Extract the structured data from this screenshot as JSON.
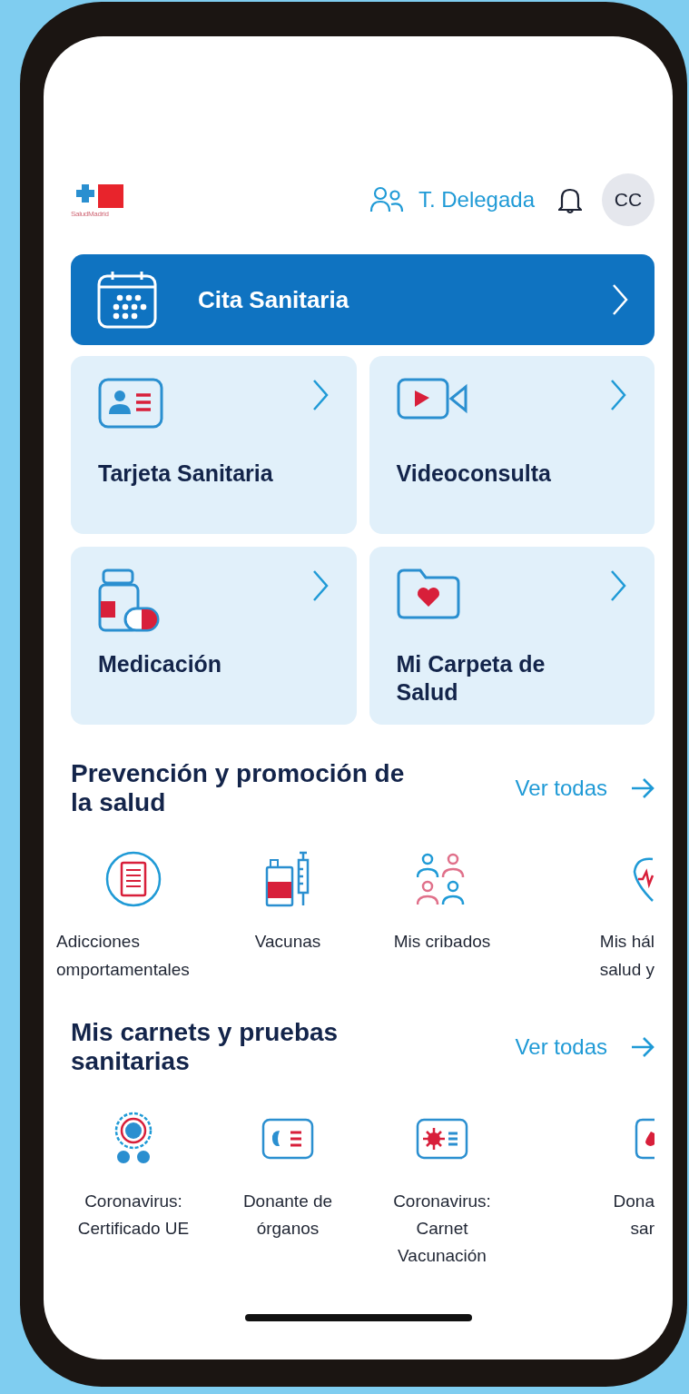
{
  "header": {
    "logo_text": "SaludMadrid",
    "delegate_label": "T. Delegada",
    "avatar_initials": "CC"
  },
  "primary_action": {
    "label": "Cita Sanitaria",
    "kind": "calendar"
  },
  "tiles": [
    {
      "label": "Tarjeta Sanitaria",
      "kind": "card"
    },
    {
      "label": "Videoconsulta",
      "kind": "video"
    },
    {
      "label": "Medicación",
      "kind": "pills"
    },
    {
      "label": "Mi Carpeta de Salud",
      "kind": "folder"
    }
  ],
  "sections": [
    {
      "title": "Prevención y promoción de la salud",
      "link": "Ver todas",
      "items": [
        {
          "lines": [
            "Adicciones",
            "omportamentales"
          ],
          "kind": "document"
        },
        {
          "lines": [
            "Vacunas"
          ],
          "kind": "vaccine"
        },
        {
          "lines": [
            "Mis cribados"
          ],
          "kind": "people"
        },
        {
          "lines": [
            "Mis hál",
            "salud y"
          ],
          "kind": "heart"
        }
      ]
    },
    {
      "title": "Mis carnets y pruebas sanitarias",
      "link": "Ver todas",
      "items": [
        {
          "lines": [
            "Coronavirus:",
            "Certificado UE"
          ],
          "kind": "badge"
        },
        {
          "lines": [
            "Donante de",
            "órganos"
          ],
          "kind": "organ"
        },
        {
          "lines": [
            "Coronavirus:",
            "Carnet",
            "Vacunación"
          ],
          "kind": "virus"
        },
        {
          "lines": [
            "Dona",
            "sar"
          ],
          "kind": "blood"
        }
      ]
    }
  ]
}
